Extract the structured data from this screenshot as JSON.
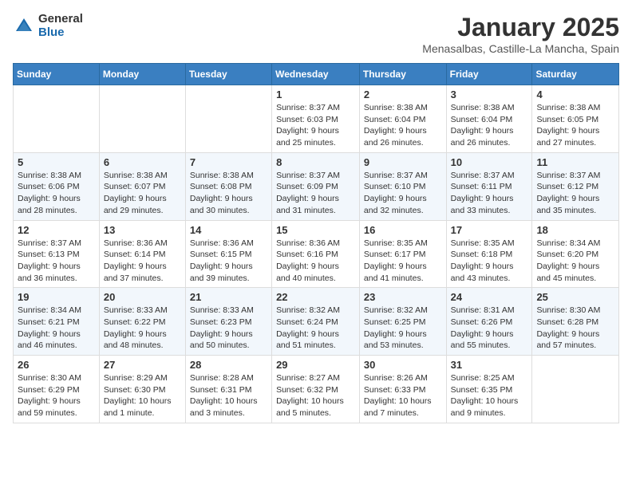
{
  "logo": {
    "general": "General",
    "blue": "Blue"
  },
  "title": "January 2025",
  "subtitle": "Menasalbas, Castille-La Mancha, Spain",
  "weekdays": [
    "Sunday",
    "Monday",
    "Tuesday",
    "Wednesday",
    "Thursday",
    "Friday",
    "Saturday"
  ],
  "weeks": [
    [
      {
        "day": "",
        "info": ""
      },
      {
        "day": "",
        "info": ""
      },
      {
        "day": "",
        "info": ""
      },
      {
        "day": "1",
        "info": "Sunrise: 8:37 AM\nSunset: 6:03 PM\nDaylight: 9 hours and 25 minutes."
      },
      {
        "day": "2",
        "info": "Sunrise: 8:38 AM\nSunset: 6:04 PM\nDaylight: 9 hours and 26 minutes."
      },
      {
        "day": "3",
        "info": "Sunrise: 8:38 AM\nSunset: 6:04 PM\nDaylight: 9 hours and 26 minutes."
      },
      {
        "day": "4",
        "info": "Sunrise: 8:38 AM\nSunset: 6:05 PM\nDaylight: 9 hours and 27 minutes."
      }
    ],
    [
      {
        "day": "5",
        "info": "Sunrise: 8:38 AM\nSunset: 6:06 PM\nDaylight: 9 hours and 28 minutes."
      },
      {
        "day": "6",
        "info": "Sunrise: 8:38 AM\nSunset: 6:07 PM\nDaylight: 9 hours and 29 minutes."
      },
      {
        "day": "7",
        "info": "Sunrise: 8:38 AM\nSunset: 6:08 PM\nDaylight: 9 hours and 30 minutes."
      },
      {
        "day": "8",
        "info": "Sunrise: 8:37 AM\nSunset: 6:09 PM\nDaylight: 9 hours and 31 minutes."
      },
      {
        "day": "9",
        "info": "Sunrise: 8:37 AM\nSunset: 6:10 PM\nDaylight: 9 hours and 32 minutes."
      },
      {
        "day": "10",
        "info": "Sunrise: 8:37 AM\nSunset: 6:11 PM\nDaylight: 9 hours and 33 minutes."
      },
      {
        "day": "11",
        "info": "Sunrise: 8:37 AM\nSunset: 6:12 PM\nDaylight: 9 hours and 35 minutes."
      }
    ],
    [
      {
        "day": "12",
        "info": "Sunrise: 8:37 AM\nSunset: 6:13 PM\nDaylight: 9 hours and 36 minutes."
      },
      {
        "day": "13",
        "info": "Sunrise: 8:36 AM\nSunset: 6:14 PM\nDaylight: 9 hours and 37 minutes."
      },
      {
        "day": "14",
        "info": "Sunrise: 8:36 AM\nSunset: 6:15 PM\nDaylight: 9 hours and 39 minutes."
      },
      {
        "day": "15",
        "info": "Sunrise: 8:36 AM\nSunset: 6:16 PM\nDaylight: 9 hours and 40 minutes."
      },
      {
        "day": "16",
        "info": "Sunrise: 8:35 AM\nSunset: 6:17 PM\nDaylight: 9 hours and 41 minutes."
      },
      {
        "day": "17",
        "info": "Sunrise: 8:35 AM\nSunset: 6:18 PM\nDaylight: 9 hours and 43 minutes."
      },
      {
        "day": "18",
        "info": "Sunrise: 8:34 AM\nSunset: 6:20 PM\nDaylight: 9 hours and 45 minutes."
      }
    ],
    [
      {
        "day": "19",
        "info": "Sunrise: 8:34 AM\nSunset: 6:21 PM\nDaylight: 9 hours and 46 minutes."
      },
      {
        "day": "20",
        "info": "Sunrise: 8:33 AM\nSunset: 6:22 PM\nDaylight: 9 hours and 48 minutes."
      },
      {
        "day": "21",
        "info": "Sunrise: 8:33 AM\nSunset: 6:23 PM\nDaylight: 9 hours and 50 minutes."
      },
      {
        "day": "22",
        "info": "Sunrise: 8:32 AM\nSunset: 6:24 PM\nDaylight: 9 hours and 51 minutes."
      },
      {
        "day": "23",
        "info": "Sunrise: 8:32 AM\nSunset: 6:25 PM\nDaylight: 9 hours and 53 minutes."
      },
      {
        "day": "24",
        "info": "Sunrise: 8:31 AM\nSunset: 6:26 PM\nDaylight: 9 hours and 55 minutes."
      },
      {
        "day": "25",
        "info": "Sunrise: 8:30 AM\nSunset: 6:28 PM\nDaylight: 9 hours and 57 minutes."
      }
    ],
    [
      {
        "day": "26",
        "info": "Sunrise: 8:30 AM\nSunset: 6:29 PM\nDaylight: 9 hours and 59 minutes."
      },
      {
        "day": "27",
        "info": "Sunrise: 8:29 AM\nSunset: 6:30 PM\nDaylight: 10 hours and 1 minute."
      },
      {
        "day": "28",
        "info": "Sunrise: 8:28 AM\nSunset: 6:31 PM\nDaylight: 10 hours and 3 minutes."
      },
      {
        "day": "29",
        "info": "Sunrise: 8:27 AM\nSunset: 6:32 PM\nDaylight: 10 hours and 5 minutes."
      },
      {
        "day": "30",
        "info": "Sunrise: 8:26 AM\nSunset: 6:33 PM\nDaylight: 10 hours and 7 minutes."
      },
      {
        "day": "31",
        "info": "Sunrise: 8:25 AM\nSunset: 6:35 PM\nDaylight: 10 hours and 9 minutes."
      },
      {
        "day": "",
        "info": ""
      }
    ]
  ]
}
